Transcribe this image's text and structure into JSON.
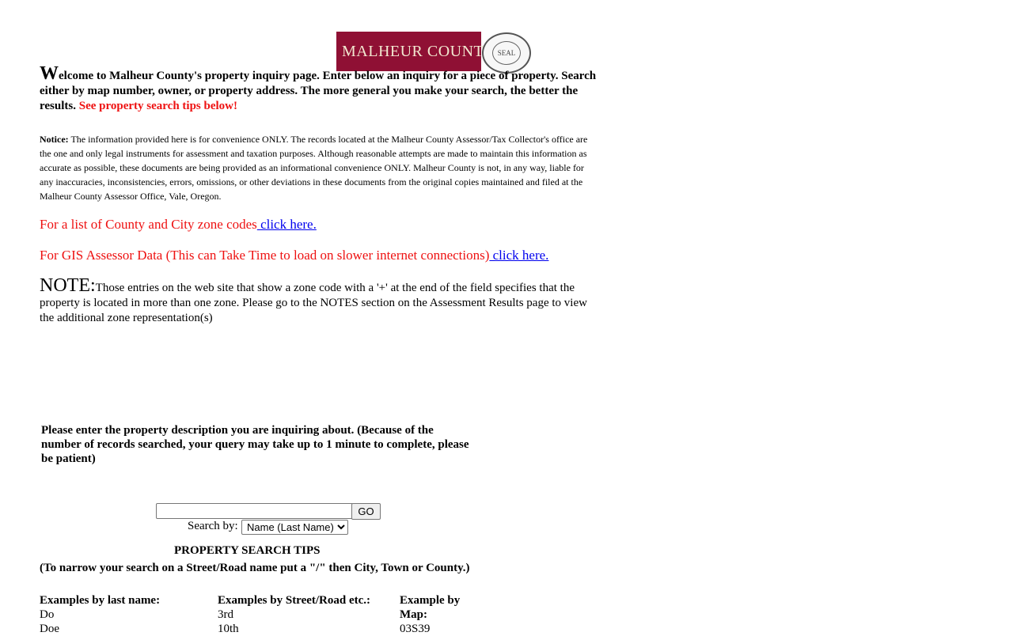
{
  "header": {
    "logo_text": "MALHEUR COUNTY",
    "seal_text": "SEAL"
  },
  "welcome": {
    "dropcap": "W",
    "text": "elcome to Malheur County's property inquiry page. Enter below an inquiry for a piece of property. Search either by map number, owner, or property address. The more general you make your search, the better the results.",
    "tips_link_text": "See property search tips below!"
  },
  "notice": {
    "label": "Notice:",
    "text": "The information provided here is for convenience ONLY. The records located at the Malheur County Assessor/Tax Collector's office are the one and only legal instruments for assessment and taxation purposes. Although reasonable attempts are made to maintain this information as accurate as possible, these documents are being provided as an informational convenience ONLY. Malheur County is not, in any way, liable for any inaccuracies, inconsistencies, errors, omissions, or other deviations in these documents from the original copies maintained and filed at the Malheur County Assessor Office, Vale, Oregon."
  },
  "zone_codes": {
    "text": "For a list of County and City zone codes",
    "link": " click here."
  },
  "gis": {
    "text": "For GIS Assessor Data (This can Take Time to load on slower internet connections)",
    "link": " click here."
  },
  "note": {
    "label": "NOTE:",
    "text": "Those entries on the web site that show a zone code with a '+' at the end of the field specifies that the property is located in more than one zone. Please go to the NOTES section on the Assessment Results page to view the additional zone representation(s)"
  },
  "search": {
    "instructions": "Please enter the property description you are inquiring about. (Because of the number of records searched, your query may take up to 1 minute to complete, please be patient)",
    "input_value": "",
    "go_label": "GO",
    "search_by_label": "Search by:",
    "search_by_selected": "Name (Last Name)"
  },
  "tips": {
    "title": "PROPERTY SEARCH TIPS",
    "subtitle": "(To narrow your search on a Street/Road name put a \"/\" then City, Town or County.)",
    "col1_head": "Examples by last name:",
    "col1_values": [
      "Do",
      "Doe"
    ],
    "col2_head": "Examples by Street/Road etc.:",
    "col2_values": [
      "3rd",
      "10th"
    ],
    "col3_head": "Example by Map:",
    "col3_values": [
      "03S39"
    ]
  }
}
